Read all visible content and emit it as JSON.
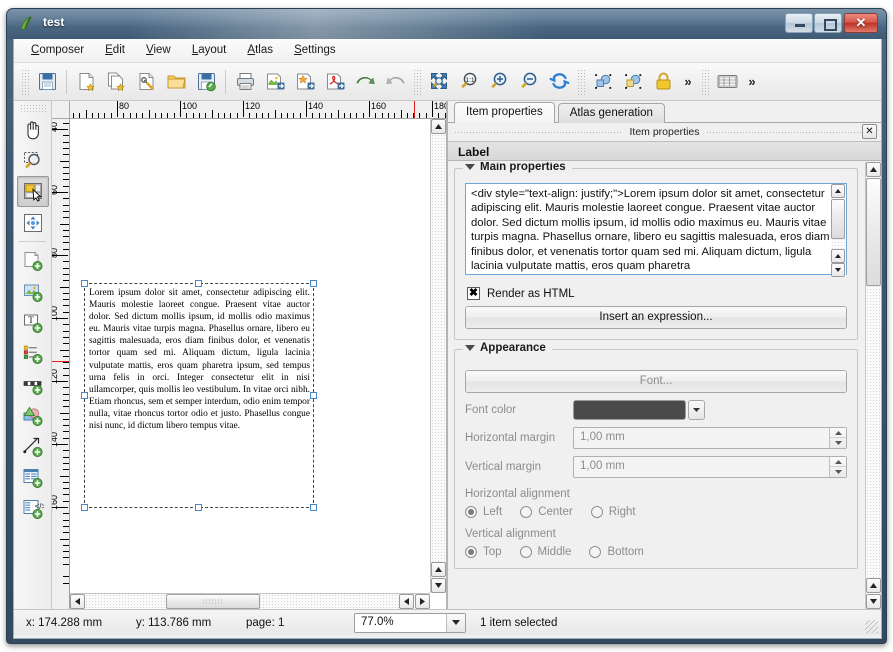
{
  "window": {
    "title": "test",
    "icon": "qgis-icon",
    "controls": {
      "minimize": "–",
      "maximize": "□",
      "close": "✕"
    }
  },
  "menubar": {
    "items": [
      {
        "label": "Composer",
        "accel": "C"
      },
      {
        "label": "Edit",
        "accel": "E"
      },
      {
        "label": "View",
        "accel": "V"
      },
      {
        "label": "Layout",
        "accel": "L"
      },
      {
        "label": "Atlas",
        "accel": "A"
      },
      {
        "label": "Settings",
        "accel": "S"
      }
    ]
  },
  "toolbar": {
    "buttons": [
      {
        "name": "save-project-button",
        "icon": "floppy-disk-icon"
      },
      {
        "name": "new-composer-button",
        "icon": "new-page-icon"
      },
      {
        "name": "duplicate-composer-button",
        "icon": "duplicate-page-icon"
      },
      {
        "name": "composer-manager-button",
        "icon": "page-wrench-icon"
      },
      {
        "name": "load-from-template-button",
        "icon": "open-folder-icon"
      },
      {
        "name": "save-as-template-button",
        "icon": "floppy-pencil-icon"
      },
      {
        "name": "print-button",
        "icon": "printer-icon"
      },
      {
        "name": "export-image-button",
        "icon": "export-image-icon"
      },
      {
        "name": "export-svg-button",
        "icon": "export-svg-icon"
      },
      {
        "name": "export-pdf-button",
        "icon": "export-pdf-icon"
      },
      {
        "name": "undo-button",
        "icon": "undo-arrow-icon"
      },
      {
        "name": "redo-button",
        "icon": "redo-arrow-icon"
      },
      {
        "name": "zoom-full-button",
        "icon": "zoom-full-icon"
      },
      {
        "name": "zoom-actual-button",
        "icon": "zoom-one-to-one-icon"
      },
      {
        "name": "zoom-in-button",
        "icon": "zoom-in-icon"
      },
      {
        "name": "zoom-out-button",
        "icon": "zoom-out-icon"
      },
      {
        "name": "refresh-view-button",
        "icon": "refresh-icon"
      },
      {
        "name": "select-all-items-button",
        "icon": "select-all-icon"
      },
      {
        "name": "deselect-all-items-button",
        "icon": "deselect-all-icon"
      },
      {
        "name": "lock-items-button",
        "icon": "padlock-icon"
      },
      {
        "name": "toolbar-overflow-button",
        "icon": "chevron-double-right-icon",
        "label": "»"
      },
      {
        "name": "atlas-preview-button",
        "icon": "atlas-table-icon"
      },
      {
        "name": "atlas-overflow-button",
        "icon": "chevron-double-right-icon",
        "label": "»"
      }
    ]
  },
  "left_toolbar": {
    "buttons": [
      {
        "name": "pan-tool",
        "icon": "hand-icon",
        "active": false
      },
      {
        "name": "zoom-tool",
        "icon": "magnifier-marquee-icon",
        "active": false
      },
      {
        "name": "select-move-item-tool",
        "icon": "select-move-item-icon",
        "active": true
      },
      {
        "name": "move-item-content-tool",
        "icon": "move-content-icon",
        "active": false
      },
      {
        "name": "add-map-tool",
        "icon": "add-map-icon",
        "active": false
      },
      {
        "name": "add-image-tool",
        "icon": "add-image-icon",
        "active": false
      },
      {
        "name": "add-label-tool",
        "icon": "add-label-icon",
        "active": false
      },
      {
        "name": "add-legend-tool",
        "icon": "add-legend-icon",
        "active": false
      },
      {
        "name": "add-scalebar-tool",
        "icon": "add-scalebar-icon",
        "active": false
      },
      {
        "name": "add-shape-tool",
        "icon": "add-shape-icon",
        "active": false
      },
      {
        "name": "add-arrow-tool",
        "icon": "add-arrow-icon",
        "active": false
      },
      {
        "name": "add-attribute-table-tool",
        "icon": "add-table-icon",
        "active": false
      },
      {
        "name": "add-html-frame-tool",
        "icon": "add-html-icon",
        "active": false
      }
    ]
  },
  "canvas": {
    "hruler": {
      "unit": "mm",
      "labels": [
        80,
        100,
        120,
        140,
        160,
        180
      ],
      "marker": 174.288
    },
    "vruler": {
      "unit": "mm",
      "labels": [
        40,
        60,
        80,
        100,
        120,
        140,
        160,
        180
      ],
      "marker": 113.786
    },
    "label_item_text": "Lorem ipsum dolor sit amet, consectetur adipiscing elit. Mauris molestie laoreet congue. Praesent vitae auctor dolor. Sed dictum mollis ipsum, id mollis odio maximus eu. Mauris vitae turpis magna. Phasellus ornare, libero eu sagittis malesuada, eros diam finibus dolor, et venenatis tortor quam sed mi. Aliquam dictum, ligula lacinia vulputate mattis, eros quam pharetra ipsum, sed tempus urna felis in orci. Integer consectetur elit in nisi ullamcorper, quis mollis leo vestibulum. In vitae orci nibh. Etiam rhoncus, sem et semper interdum, odio enim tempor nulla, vitae rhoncus tortor odio et justo. Phasellus congue nisi nunc, id dictum libero tempus vitae."
  },
  "dock": {
    "tabs": [
      {
        "label": "Item properties",
        "active": true
      },
      {
        "label": "Atlas generation",
        "active": false
      }
    ],
    "title": "Item properties",
    "close_label": "✕",
    "section_title": "Label",
    "main_properties": {
      "header": "Main properties",
      "html_text": "<div style=\"text-align: justify;\">Lorem ipsum dolor sit amet, consectetur adipiscing elit. Mauris molestie laoreet congue. Praesent vitae auctor dolor. Sed dictum mollis ipsum, id mollis odio maximus eu. Mauris vitae turpis magna. Phasellus ornare, libero eu sagittis malesuada, eros diam finibus dolor, et venenatis tortor quam sed mi. Aliquam dictum, ligula lacinia vulputate mattis, eros quam pharetra",
      "render_as_html_label": "Render as HTML",
      "render_as_html_checked": "✖",
      "insert_expression_label": "Insert an expression..."
    },
    "appearance": {
      "header": "Appearance",
      "font_button_label": "Font...",
      "font_color_label": "Font color",
      "font_color_value": "#4a4a4a",
      "horizontal_margin_label": "Horizontal margin",
      "horizontal_margin_value": "1,00 mm",
      "vertical_margin_label": "Vertical margin",
      "vertical_margin_value": "1,00 mm",
      "horizontal_alignment_label": "Horizontal alignment",
      "horizontal_alignment_options": [
        {
          "label": "Left",
          "selected": true
        },
        {
          "label": "Center",
          "selected": false
        },
        {
          "label": "Right",
          "selected": false
        }
      ],
      "vertical_alignment_label": "Vertical alignment",
      "vertical_alignment_options": [
        {
          "label": "Top",
          "selected": true
        },
        {
          "label": "Middle",
          "selected": false
        },
        {
          "label": "Bottom",
          "selected": false
        }
      ]
    }
  },
  "statusbar": {
    "x": "x: 174.288 mm",
    "y": "y: 113.786 mm",
    "page": "page: 1",
    "zoom": "77.0%",
    "selection": "1 item selected"
  }
}
